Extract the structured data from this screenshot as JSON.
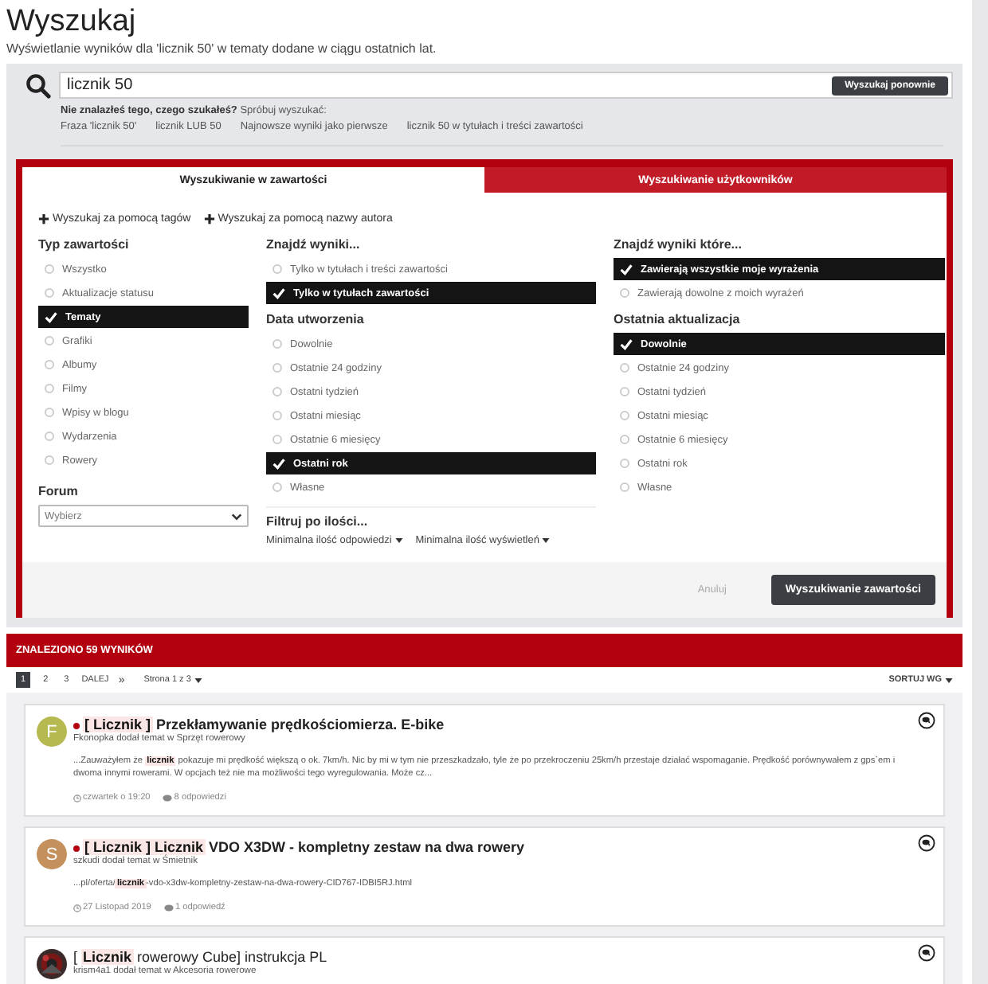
{
  "page": {
    "title": "Wyszukaj",
    "subtitle": "Wyświetlanie wyników dla 'licznik 50' w tematy dodane w ciągu ostatnich lat."
  },
  "search": {
    "value": "licznik 50",
    "button": "Wyszukaj ponownie",
    "hint_bold": "Nie znalazłeś tego, czego szukałeś?",
    "hint": "Spróbuj wyszukać:",
    "suggestions": [
      "Fraza 'licznik 50'",
      "licznik LUB 50",
      "Najnowsze wyniki jako pierwsze",
      "licznik 50 w tytułach i treści zawartości"
    ]
  },
  "tabs": [
    {
      "label": "Wyszukiwanie w zawartości",
      "selected": true
    },
    {
      "label": "Wyszukiwanie użytkowników",
      "selected": false
    }
  ],
  "add_links": [
    "Wyszukaj za pomocą tagów",
    "Wyszukaj za pomocą nazwy autora"
  ],
  "content_type": {
    "title": "Typ zawartości",
    "options": [
      {
        "label": "Wszystko",
        "selected": false
      },
      {
        "label": "Aktualizacje statusu",
        "selected": false
      },
      {
        "label": "Tematy",
        "selected": true
      },
      {
        "label": "Grafiki",
        "selected": false
      },
      {
        "label": "Albumy",
        "selected": false
      },
      {
        "label": "Filmy",
        "selected": false
      },
      {
        "label": "Wpisy w blogu",
        "selected": false
      },
      {
        "label": "Wydarzenia",
        "selected": false
      },
      {
        "label": "Rowery",
        "selected": false
      }
    ]
  },
  "forum": {
    "title": "Forum",
    "placeholder": "Wybierz"
  },
  "find_results": {
    "title": "Znajdź wyniki...",
    "options": [
      {
        "label": "Tylko w tytułach i treści zawartości",
        "selected": false
      },
      {
        "label": "Tylko w tytułach zawartości",
        "selected": true
      }
    ]
  },
  "created": {
    "title": "Data utworzenia",
    "options": [
      {
        "label": "Dowolnie",
        "selected": false
      },
      {
        "label": "Ostatnie 24 godziny",
        "selected": false
      },
      {
        "label": "Ostatni tydzień",
        "selected": false
      },
      {
        "label": "Ostatni miesiąc",
        "selected": false
      },
      {
        "label": "Ostatnie 6 miesięcy",
        "selected": false
      },
      {
        "label": "Ostatni rok",
        "selected": true
      },
      {
        "label": "Własne",
        "selected": false
      }
    ]
  },
  "find_which": {
    "title": "Znajdź wyniki które...",
    "options": [
      {
        "label": "Zawierają wszystkie moje wyrażenia",
        "selected": true
      },
      {
        "label": "Zawierają dowolne z moich wyrażeń",
        "selected": false
      }
    ]
  },
  "updated": {
    "title": "Ostatnia aktualizacja",
    "options": [
      {
        "label": "Dowolnie",
        "selected": true
      },
      {
        "label": "Ostatnie 24 godziny",
        "selected": false
      },
      {
        "label": "Ostatni tydzień",
        "selected": false
      },
      {
        "label": "Ostatni miesiąc",
        "selected": false
      },
      {
        "label": "Ostatnie 6 miesięcy",
        "selected": false
      },
      {
        "label": "Ostatni rok",
        "selected": false
      },
      {
        "label": "Własne",
        "selected": false
      }
    ]
  },
  "filter": {
    "title": "Filtruj po ilości...",
    "dropdowns": [
      "Minimalna ilość odpowiedzi",
      "Minimalna ilość wyświetleń"
    ]
  },
  "actions": {
    "cancel": "Anuluj",
    "submit": "Wyszukiwanie zawartości"
  },
  "results_bar": "ZNALEZIONO 59 WYNIKÓW",
  "pagination": {
    "pages": [
      {
        "label": "1",
        "selected": true
      },
      {
        "label": "2",
        "selected": false
      },
      {
        "label": "3",
        "selected": false
      }
    ],
    "next": "DALEJ",
    "last": "»",
    "page_of": "Strona 1 z 3",
    "sort": "SORTUJ WG"
  },
  "results": [
    {
      "avatar": {
        "kind": "letter",
        "letter": "F",
        "color": "#b5b94f"
      },
      "unread": true,
      "title": "**[ Licznik ]** Przekłamywanie prędkościomierza. E-bike",
      "byline": "Fkonopka dodał temat w Sprzęt rowerowy",
      "excerpt": "...Zauważyłem że **licznik** pokazuje mi prędkość większą o ok. 7km/h. Nic by mi w tym nie przeszkadzało, tyle że po przekroczeniu 25km/h przestaje działać wspomaganie. Prędkość porównywałem z gps`em i dwoma innymi rowerami. W opcjach też nie ma możliwości tego wyregulowania. Może cz...",
      "date": "czwartek o 19:20",
      "replies": "8 odpowiedzi"
    },
    {
      "avatar": {
        "kind": "letter",
        "letter": "S",
        "color": "#c4905c"
      },
      "unread": true,
      "title": "**[ Licznik ] Licznik** VDO X3DW - kompletny zestaw na dwa rowery",
      "byline": "szkudi dodał temat w Śmietnik",
      "excerpt": "...pl/oferta/**licznik**-vdo-x3dw-kompletny-zestaw-na-dwa-rowery-CID767-IDBI5RJ.html",
      "date": "27 Listopad 2019",
      "replies": "1 odpowiedź"
    },
    {
      "unread": false,
      "title": "[ **Licznik** rowerowy Cube] instrukcja PL",
      "byline": "krism4a1 dodał temat w Akcesoria rowerowe"
    }
  ]
}
